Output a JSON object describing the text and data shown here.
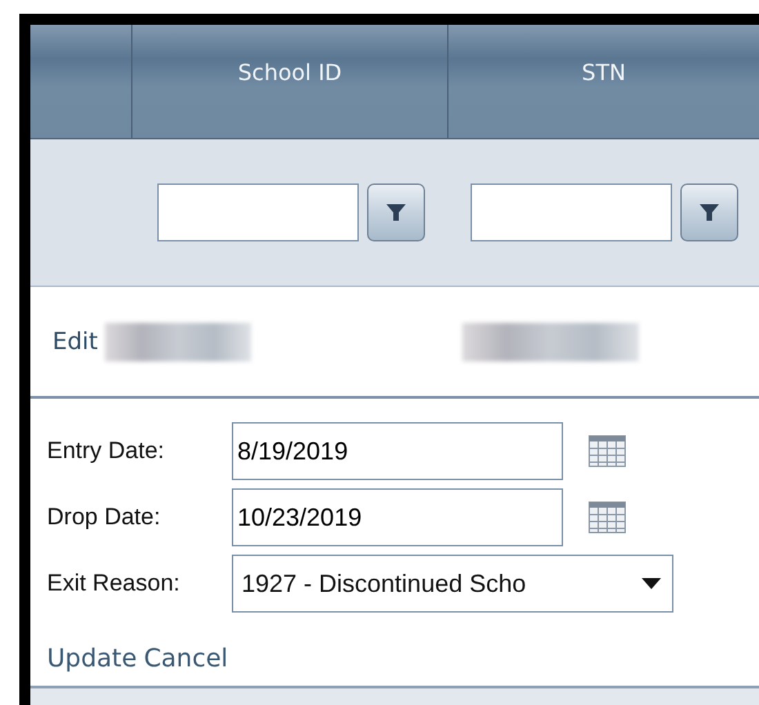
{
  "grid": {
    "columns": [
      {
        "kind": "command"
      },
      {
        "kind": "data",
        "label": "School ID"
      },
      {
        "kind": "data",
        "label": "STN"
      }
    ],
    "row": {
      "edit_link": "Edit"
    }
  },
  "edit_form": {
    "entry_date": {
      "label": "Entry Date:",
      "value": "8/19/2019"
    },
    "drop_date": {
      "label": "Drop Date:",
      "value": "10/23/2019"
    },
    "exit_reason": {
      "label": "Exit Reason:",
      "value": "1927 - Discontinued Scho"
    },
    "actions": [
      "Update",
      "Cancel"
    ]
  }
}
